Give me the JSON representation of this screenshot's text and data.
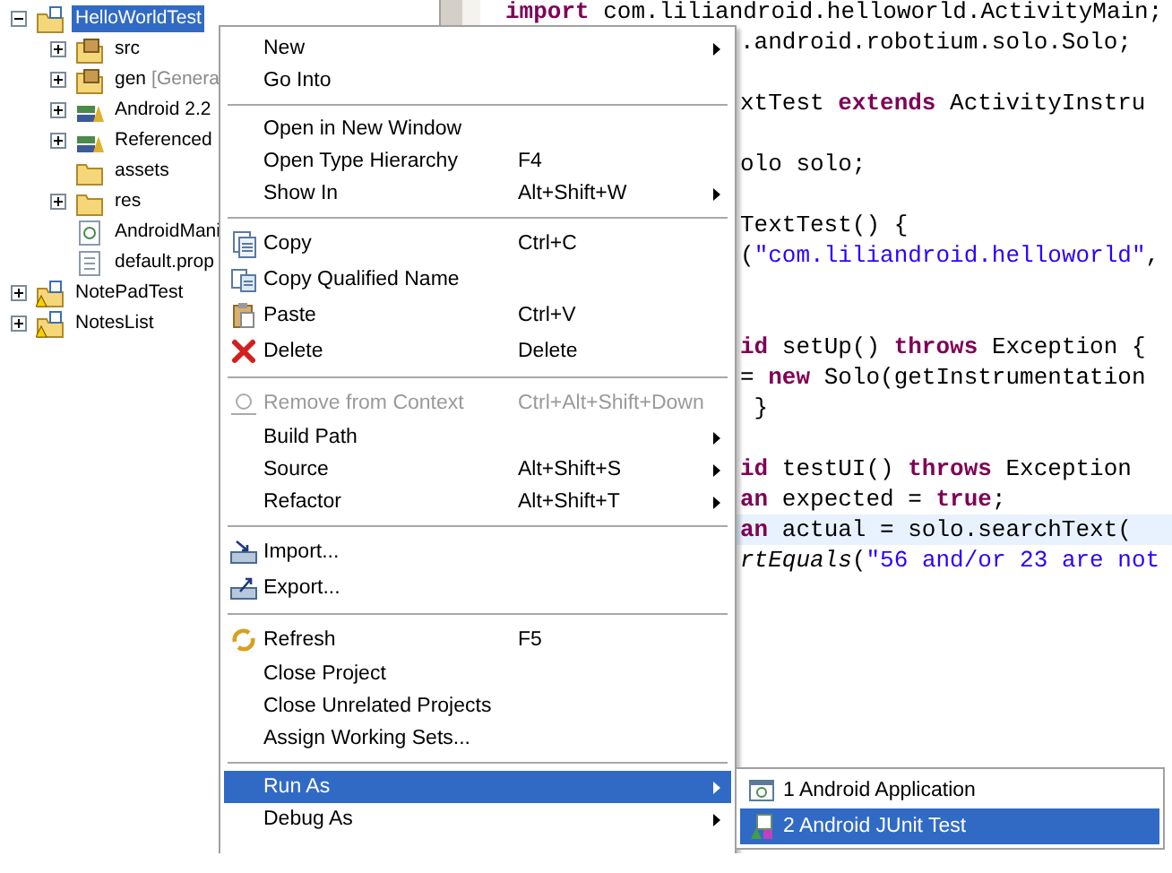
{
  "tree": [
    {
      "label": "HelloWorldTest",
      "kind": "project",
      "expanded": true,
      "selected": true,
      "warning": false,
      "children": [
        {
          "label": "src",
          "kind": "srcfolder",
          "expanded": false,
          "selected": false
        },
        {
          "label": "gen",
          "decoration": "[Genera",
          "kind": "srcfolder",
          "expanded": false,
          "selected": false
        },
        {
          "label": "Android 2.2",
          "kind": "library",
          "expanded": false,
          "selected": false
        },
        {
          "label": "Referenced",
          "kind": "library",
          "expanded": false,
          "selected": false
        },
        {
          "label": "assets",
          "kind": "folder",
          "selected": false
        },
        {
          "label": "res",
          "kind": "folder",
          "expanded": false,
          "selected": false
        },
        {
          "label": "AndroidMani",
          "kind": "manifest",
          "selected": false
        },
        {
          "label": "default.prop",
          "kind": "file",
          "selected": false
        }
      ]
    },
    {
      "label": "NotePadTest",
      "kind": "project",
      "expanded": false,
      "selected": false,
      "warning": true
    },
    {
      "label": "NotesList",
      "kind": "project",
      "expanded": false,
      "selected": false,
      "warning": true
    }
  ],
  "code": [
    {
      "kind": "full",
      "highlighted": false,
      "parts": [
        {
          "kind": "keyword",
          "text": "import"
        },
        {
          "kind": "plain",
          "text": " com.liliandroid.helloworld.ActivityMain;"
        }
      ]
    },
    {
      "kind": "clipped",
      "highlighted": false,
      "parts": [
        {
          "kind": "plain",
          "text": ".android.robotium.solo.Solo;"
        }
      ]
    },
    {
      "kind": "blank"
    },
    {
      "kind": "clipped",
      "highlighted": false,
      "parts": [
        {
          "kind": "plain",
          "text": "xtTest "
        },
        {
          "kind": "keyword",
          "text": "extends"
        },
        {
          "kind": "plain",
          "text": " ActivityInstru"
        }
      ]
    },
    {
      "kind": "blank"
    },
    {
      "kind": "clipped",
      "highlighted": false,
      "parts": [
        {
          "kind": "plain",
          "text": "olo solo;"
        }
      ]
    },
    {
      "kind": "blank"
    },
    {
      "kind": "clipped",
      "highlighted": false,
      "parts": [
        {
          "kind": "plain",
          "text": "TextTest() {"
        }
      ]
    },
    {
      "kind": "clipped",
      "highlighted": false,
      "parts": [
        {
          "kind": "plain",
          "text": "("
        },
        {
          "kind": "string",
          "text": "\"com.liliandroid.helloworld\""
        },
        {
          "kind": "plain",
          "text": ","
        }
      ]
    },
    {
      "kind": "blank"
    },
    {
      "kind": "blank"
    },
    {
      "kind": "clipped",
      "highlighted": false,
      "parts": [
        {
          "kind": "keyword",
          "text": "id"
        },
        {
          "kind": "plain",
          "text": " setUp() "
        },
        {
          "kind": "keyword",
          "text": "throws"
        },
        {
          "kind": "plain",
          "text": " Exception {"
        }
      ]
    },
    {
      "kind": "clipped",
      "highlighted": false,
      "parts": [
        {
          "kind": "plain",
          "text": "= "
        },
        {
          "kind": "keyword",
          "text": "new"
        },
        {
          "kind": "plain",
          "text": " Solo(getInstrumentation"
        }
      ]
    },
    {
      "kind": "clipped",
      "highlighted": false,
      "parts": [
        {
          "kind": "plain",
          "text": " }"
        }
      ]
    },
    {
      "kind": "blank"
    },
    {
      "kind": "clipped",
      "highlighted": false,
      "parts": [
        {
          "kind": "keyword",
          "text": "id"
        },
        {
          "kind": "plain",
          "text": " testUI() "
        },
        {
          "kind": "keyword",
          "text": "throws"
        },
        {
          "kind": "plain",
          "text": " Exception"
        }
      ]
    },
    {
      "kind": "clipped",
      "highlighted": false,
      "parts": [
        {
          "kind": "keyword",
          "text": "an"
        },
        {
          "kind": "plain",
          "text": " expected = "
        },
        {
          "kind": "keyword",
          "text": "true"
        },
        {
          "kind": "plain",
          "text": ";"
        }
      ]
    },
    {
      "kind": "clipped",
      "highlighted": true,
      "parts": [
        {
          "kind": "keyword",
          "text": "an"
        },
        {
          "kind": "plain",
          "text": " actual = solo.searchText("
        }
      ]
    },
    {
      "kind": "clipped",
      "highlighted": false,
      "parts": [
        {
          "kind": "italic",
          "text": "rtEquals"
        },
        {
          "kind": "plain",
          "text": "("
        },
        {
          "kind": "string",
          "text": "\"56 and/or 23 are not"
        }
      ]
    }
  ],
  "context_menu": {
    "groups": [
      [
        {
          "label": "New",
          "kind": "plain",
          "submenu": true,
          "disabled": false,
          "selected": false
        },
        {
          "label": "Go Into",
          "kind": "plain",
          "submenu": false,
          "disabled": false,
          "selected": false
        }
      ],
      [
        {
          "label": "Open in New Window",
          "kind": "plain",
          "submenu": false,
          "disabled": false,
          "selected": false
        },
        {
          "label": "Open Type Hierarchy",
          "shortcut": "F4",
          "kind": "plain",
          "submenu": false,
          "disabled": false,
          "selected": false
        },
        {
          "label": "Show In",
          "shortcut": "Alt+Shift+W",
          "kind": "plain",
          "submenu": true,
          "disabled": false,
          "selected": false
        }
      ],
      [
        {
          "label": "Copy",
          "shortcut": "Ctrl+C",
          "kind": "copy",
          "submenu": false,
          "disabled": false,
          "selected": false
        },
        {
          "label": "Copy Qualified Name",
          "kind": "copyname",
          "submenu": false,
          "disabled": false,
          "selected": false
        },
        {
          "label": "Paste",
          "shortcut": "Ctrl+V",
          "kind": "paste",
          "submenu": false,
          "disabled": false,
          "selected": false
        },
        {
          "label": "Delete",
          "shortcut": "Delete",
          "kind": "delete",
          "submenu": false,
          "disabled": false,
          "selected": false
        }
      ],
      [
        {
          "label": "Remove from Context",
          "shortcut": "Ctrl+Alt+Shift+Down",
          "kind": "remove",
          "submenu": false,
          "disabled": true,
          "selected": false
        },
        {
          "label": "Build Path",
          "kind": "plain",
          "submenu": true,
          "disabled": false,
          "selected": false
        },
        {
          "label": "Source",
          "shortcut": "Alt+Shift+S",
          "kind": "plain",
          "submenu": true,
          "disabled": false,
          "selected": false
        },
        {
          "label": "Refactor",
          "shortcut": "Alt+Shift+T",
          "kind": "plain",
          "submenu": true,
          "disabled": false,
          "selected": false
        }
      ],
      [
        {
          "label": "Import...",
          "kind": "import",
          "submenu": false,
          "disabled": false,
          "selected": false
        },
        {
          "label": "Export...",
          "kind": "export",
          "submenu": false,
          "disabled": false,
          "selected": false
        }
      ],
      [
        {
          "label": "Refresh",
          "shortcut": "F5",
          "kind": "refresh",
          "submenu": false,
          "disabled": false,
          "selected": false
        },
        {
          "label": "Close Project",
          "kind": "plain",
          "submenu": false,
          "disabled": false,
          "selected": false
        },
        {
          "label": "Close Unrelated Projects",
          "kind": "plain",
          "submenu": false,
          "disabled": false,
          "selected": false
        },
        {
          "label": "Assign Working Sets...",
          "kind": "plain",
          "submenu": false,
          "disabled": false,
          "selected": false
        }
      ],
      [
        {
          "label": "Run As",
          "kind": "plain",
          "submenu": true,
          "disabled": false,
          "selected": true
        },
        {
          "label": "Debug As",
          "kind": "plain",
          "submenu": true,
          "disabled": false,
          "selected": false
        }
      ]
    ]
  },
  "submenu": [
    {
      "label": "1 Android Application",
      "kind": "app",
      "selected": false
    },
    {
      "label": "2 Android JUnit Test",
      "kind": "junit",
      "selected": true
    }
  ]
}
